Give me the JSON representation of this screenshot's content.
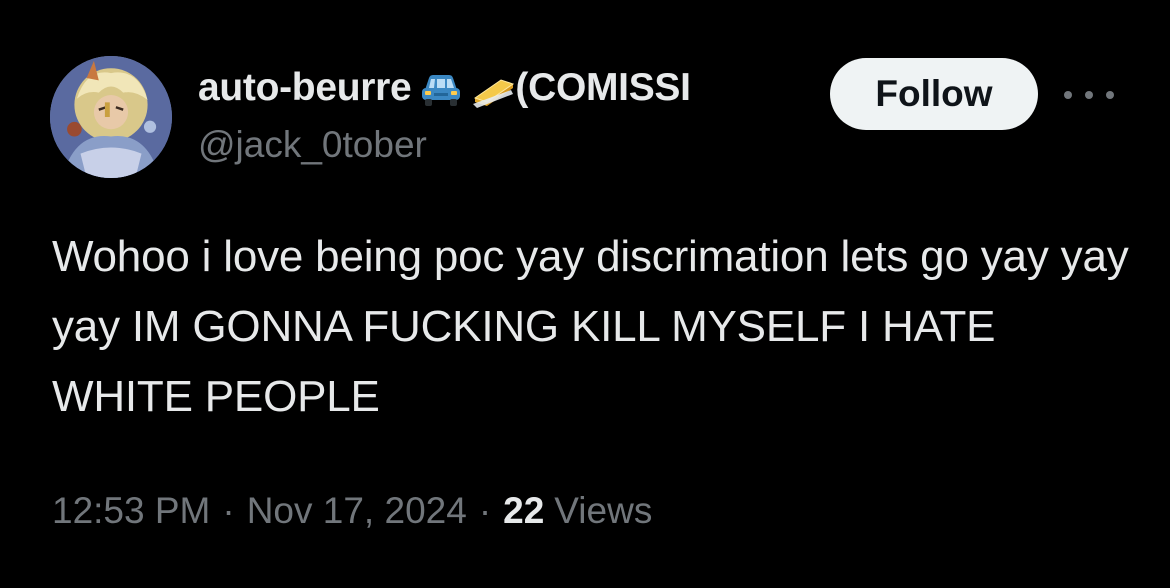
{
  "author": {
    "display_name": "auto-beurre",
    "name_suffix": "(COMISSI",
    "name_emojis": [
      "car-emoji",
      "butter-emoji"
    ],
    "handle": "@jack_0tober",
    "avatar": "anime-character-avatar"
  },
  "actions": {
    "follow_label": "Follow",
    "more_icon": "ellipsis-icon"
  },
  "tweet": {
    "text": "Wohoo i love being poc yay discrimation lets go yay yay yay IM GONNA FUCKING KILL MYSELF I HATE WHITE PEOPLE"
  },
  "meta": {
    "time": "12:53 PM",
    "separator": "·",
    "date": "Nov 17, 2024",
    "views_count": "22",
    "views_label": "Views"
  },
  "colors": {
    "background": "#000000",
    "text_primary": "#e7e9ea",
    "text_secondary": "#71767b",
    "follow_bg": "#eff3f4",
    "follow_text": "#0f1419"
  }
}
